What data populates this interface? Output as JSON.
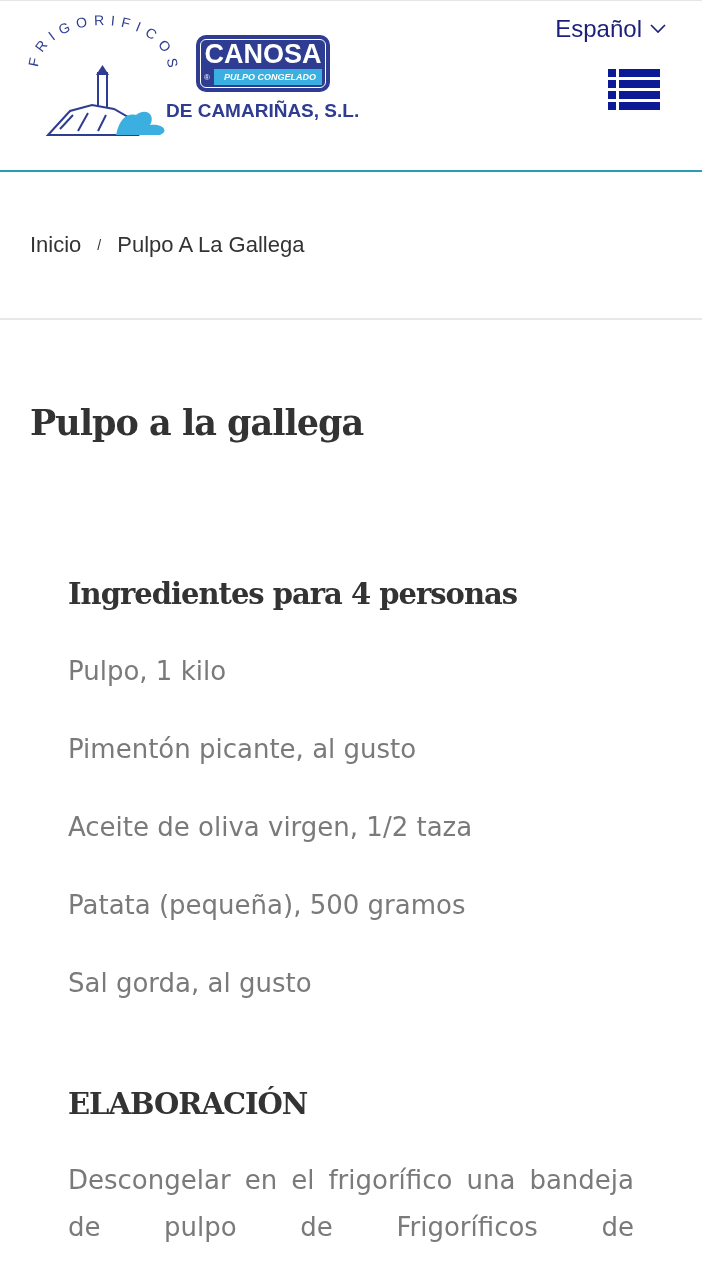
{
  "header": {
    "logo": {
      "arc_text": "FRIGORIFICOS",
      "brand": "CANOSA",
      "tagline": "PULPO CONGELADO",
      "registered": "®",
      "company": "DE CAMARIÑAS, S.L."
    },
    "language": "Español"
  },
  "breadcrumb": [
    "Inicio",
    "Pulpo A La Gallega"
  ],
  "breadcrumb_separator": "/",
  "title": "Pulpo a la gallega",
  "ingredients": {
    "heading": "Ingredientes para 4 personas",
    "items": [
      "Pulpo, 1 kilo",
      "Pimentón picante, al gusto",
      "Aceite de oliva virgen, 1/2 taza",
      "Patata (pequeña), 500 gramos",
      "Sal gorda, al gusto"
    ]
  },
  "preparation": {
    "heading": "ELABORACIÓN",
    "text": "Descongelar en el frigorífico una bandeja de pulpo de Frigoríficos de"
  }
}
